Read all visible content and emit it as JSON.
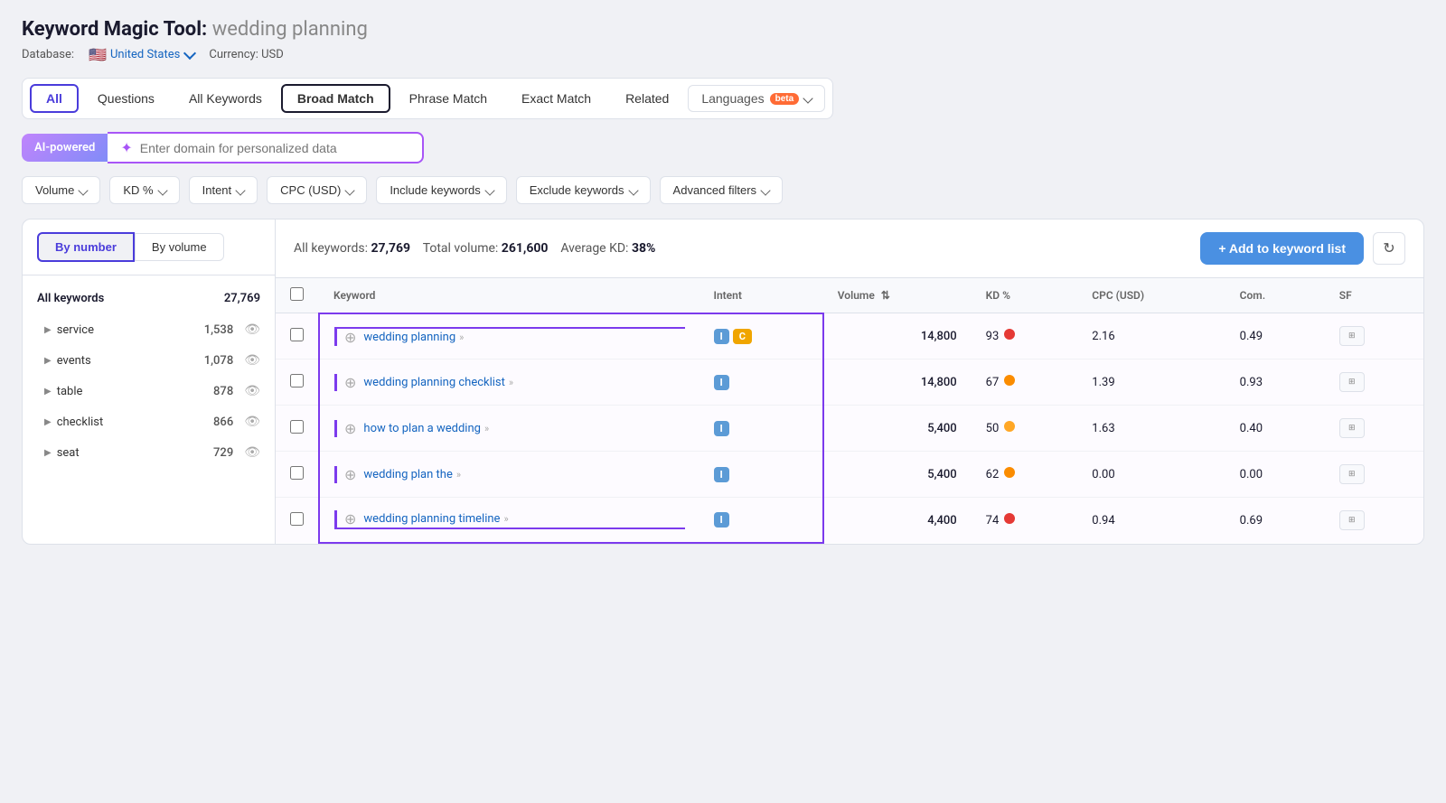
{
  "page": {
    "title": "Keyword Magic Tool:",
    "query": "wedding planning",
    "database_label": "Database:",
    "database_value": "United States",
    "currency_label": "Currency: USD"
  },
  "tabs": [
    {
      "id": "all",
      "label": "All",
      "active": false,
      "class": "tab-all"
    },
    {
      "id": "questions",
      "label": "Questions",
      "active": false
    },
    {
      "id": "all-keywords",
      "label": "All Keywords",
      "active": false
    },
    {
      "id": "broad-match",
      "label": "Broad Match",
      "active": true,
      "class": "tab-broad"
    },
    {
      "id": "phrase-match",
      "label": "Phrase Match",
      "active": false
    },
    {
      "id": "exact-match",
      "label": "Exact Match",
      "active": false
    },
    {
      "id": "related",
      "label": "Related",
      "active": false
    }
  ],
  "languages_btn": "Languages",
  "beta_label": "beta",
  "ai": {
    "label": "AI-powered",
    "placeholder": "Enter domain for personalized data"
  },
  "filters": [
    {
      "id": "volume",
      "label": "Volume"
    },
    {
      "id": "kd",
      "label": "KD %"
    },
    {
      "id": "intent",
      "label": "Intent"
    },
    {
      "id": "cpc",
      "label": "CPC (USD)"
    },
    {
      "id": "include-keywords",
      "label": "Include keywords"
    },
    {
      "id": "exclude-keywords",
      "label": "Exclude keywords"
    },
    {
      "id": "advanced-filters",
      "label": "Advanced filters"
    }
  ],
  "sidebar": {
    "sort_by_number": "By number",
    "sort_by_volume": "By volume",
    "header_label": "All keywords",
    "header_count": "27,769",
    "items": [
      {
        "name": "service",
        "count": "1,538"
      },
      {
        "name": "events",
        "count": "1,078"
      },
      {
        "name": "table",
        "count": "878"
      },
      {
        "name": "checklist",
        "count": "866"
      },
      {
        "name": "seat",
        "count": "729"
      }
    ]
  },
  "table": {
    "stats": {
      "all_keywords_label": "All keywords:",
      "all_keywords_value": "27,769",
      "total_volume_label": "Total volume:",
      "total_volume_value": "261,600",
      "avg_kd_label": "Average KD:",
      "avg_kd_value": "38%"
    },
    "add_btn": "+ Add to keyword list",
    "columns": [
      "Keyword",
      "Intent",
      "Volume",
      "KD %",
      "CPC (USD)",
      "Com.",
      "SF"
    ],
    "rows": [
      {
        "keyword": "wedding planning",
        "keyword_arrows": ">>",
        "intent": [
          "I",
          "C"
        ],
        "volume": "14,800",
        "kd": "93",
        "kd_color": "red",
        "cpc": "2.16",
        "com": "0.49",
        "highlighted": true
      },
      {
        "keyword": "wedding planning checklist",
        "keyword_arrows": ">>",
        "intent": [
          "I"
        ],
        "volume": "14,800",
        "kd": "67",
        "kd_color": "orange",
        "cpc": "1.39",
        "com": "0.93",
        "highlighted": true
      },
      {
        "keyword": "how to plan a wedding",
        "keyword_arrows": ">>",
        "intent": [
          "I"
        ],
        "volume": "5,400",
        "kd": "50",
        "kd_color": "light-orange",
        "cpc": "1.63",
        "com": "0.40",
        "highlighted": true
      },
      {
        "keyword": "wedding plan the",
        "keyword_arrows": ">>",
        "intent": [
          "I"
        ],
        "volume": "5,400",
        "kd": "62",
        "kd_color": "orange",
        "cpc": "0.00",
        "com": "0.00",
        "highlighted": true
      },
      {
        "keyword": "wedding planning timeline",
        "keyword_arrows": ">>",
        "intent": [
          "I"
        ],
        "volume": "4,400",
        "kd": "74",
        "kd_color": "red",
        "cpc": "0.94",
        "com": "0.69",
        "highlighted": true
      }
    ]
  }
}
